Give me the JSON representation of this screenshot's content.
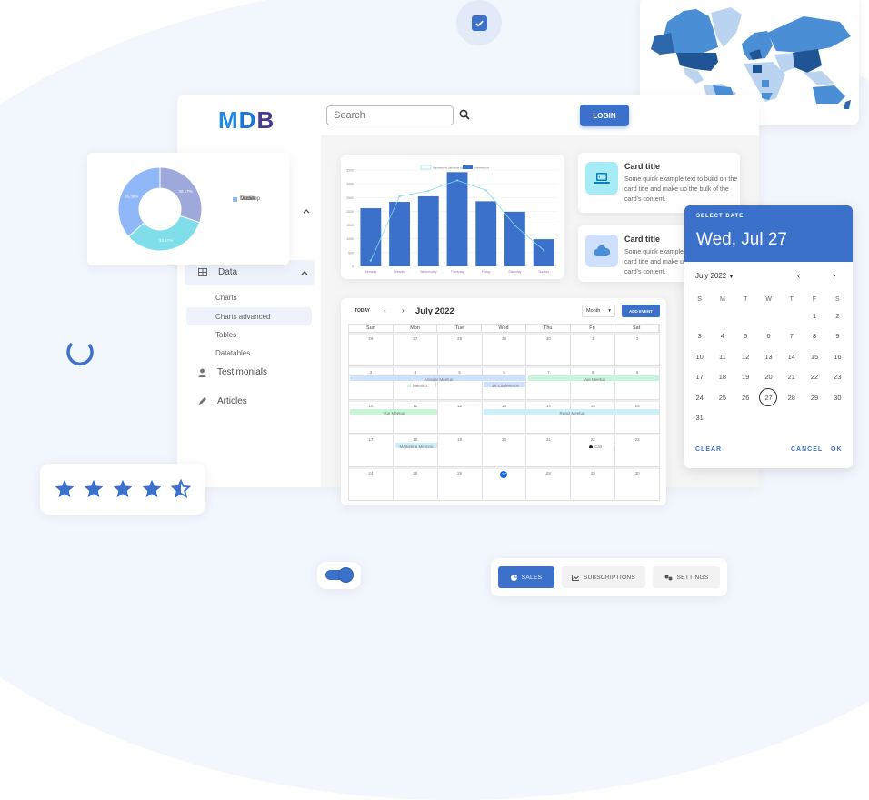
{
  "app": {
    "logo": {
      "m": "M",
      "d": "D",
      "b": "B"
    },
    "search": {
      "placeholder": "Search"
    },
    "login_label": "LOGIN"
  },
  "sidebar": {
    "data_label": "Data",
    "sub_items": [
      "Charts",
      "Charts advanced",
      "Tables",
      "Datatables"
    ],
    "active_sub": "Charts advanced",
    "testimonials_label": "Testimonials",
    "articles_label": "Articles"
  },
  "pie_chart": {
    "chart_data": {
      "type": "pie",
      "categories": [
        "Desktop",
        "Mobile",
        "Tablet"
      ],
      "values": [
        30.17,
        33.47,
        36.36
      ],
      "value_labels": [
        "30.17%",
        "33.47%",
        "36.36%"
      ],
      "colors": [
        "#9fa8da",
        "#80deea",
        "#90b8f8"
      ],
      "legend": "right"
    }
  },
  "bar_chart": {
    "chart_data": {
      "type": "bar",
      "categories": [
        "Monday",
        "Tuesday",
        "Wednesday",
        "Thursday",
        "Friday",
        "Saturday",
        "Sunday"
      ],
      "series": [
        {
          "name": "Impressions",
          "type": "bar",
          "values": [
            2112,
            2343,
            2545,
            3423,
            2365,
            1985,
            987
          ]
        },
        {
          "name": "Impressions (absolute top) %",
          "type": "line",
          "values": [
            211,
            2543,
            2745,
            3123,
            2765,
            1485,
            587
          ]
        }
      ],
      "yticks": [
        0,
        500,
        1000,
        1500,
        2000,
        2500,
        3000,
        3500
      ],
      "ytick_labels": [
        "0",
        "500",
        "1000",
        "1500",
        "2000",
        "2500",
        "3000",
        "3500"
      ],
      "ylim": [
        0,
        3500
      ],
      "legend": "top",
      "grid": true,
      "colors": {
        "bar": "#3b71ca",
        "line": "#80deea"
      }
    }
  },
  "cards": [
    {
      "title": "Card title",
      "text": "Some quick example text to build on the card title and make up the bulk of the card's content.",
      "icon": "laptop-code-icon"
    },
    {
      "title": "Card title",
      "text": "Some quick example text to build on the card title and make up the bulk of the card's content.",
      "icon": "cloud-icon"
    }
  ],
  "calendar": {
    "today_label": "TODAY",
    "month_title": "July 2022",
    "view_select": "Month",
    "add_event_label": "ADD EVENT",
    "days_of_week": [
      "Sun",
      "Mon",
      "Tue",
      "Wed",
      "Thu",
      "Fri",
      "Sat"
    ],
    "weeks": [
      [
        "26",
        "27",
        "28",
        "29",
        "30",
        "1",
        "2"
      ],
      [
        "3",
        "4",
        "5",
        "6",
        "7",
        "8",
        "9"
      ],
      [
        "10",
        "11",
        "12",
        "13",
        "14",
        "15",
        "16"
      ],
      [
        "17",
        "18",
        "19",
        "20",
        "21",
        "22",
        "23"
      ],
      [
        "24",
        "25",
        "26",
        "27",
        "28",
        "29",
        "30"
      ]
    ],
    "today_date": "27",
    "events": [
      {
        "label": "Angular Meetup",
        "color": "#cfe0fc"
      },
      {
        "label": "Vue Meetup",
        "color": "#c7f5d9"
      },
      {
        "label": "Meeting",
        "color": "#c7f5d9"
      },
      {
        "label": "JS Conference",
        "color": "#cfe0fc"
      },
      {
        "label": "Vue Meetup",
        "color": "#c7f5d9"
      },
      {
        "label": "React Meetup",
        "color": "#cdeffa"
      },
      {
        "label": "Marketing Meeting",
        "color": "#cdeffa"
      },
      {
        "label": "Call",
        "color": "#262626"
      }
    ]
  },
  "datepicker": {
    "header_label": "SELECT DATE",
    "selected_display": "Wed, Jul 27",
    "month_year": "July 2022",
    "dow": [
      "S",
      "M",
      "T",
      "W",
      "T",
      "F",
      "S"
    ],
    "leading_blanks": 5,
    "days_in_month": 31,
    "selected_day": "27",
    "clear_label": "CLEAR",
    "cancel_label": "CANCEL",
    "ok_label": "OK"
  },
  "rating": {
    "value": 4.5,
    "max": 5
  },
  "toggle": {
    "checked": true
  },
  "tabs": [
    {
      "label": "SALES",
      "icon": "chart-pie-icon",
      "active": true
    },
    {
      "label": "SUBSCRIPTIONS",
      "icon": "chart-line-icon",
      "active": false
    },
    {
      "label": "SETTINGS",
      "icon": "cogs-icon",
      "active": false
    }
  ],
  "colors": {
    "primary": "#3b71ca",
    "bg": "#f2f6fd"
  }
}
